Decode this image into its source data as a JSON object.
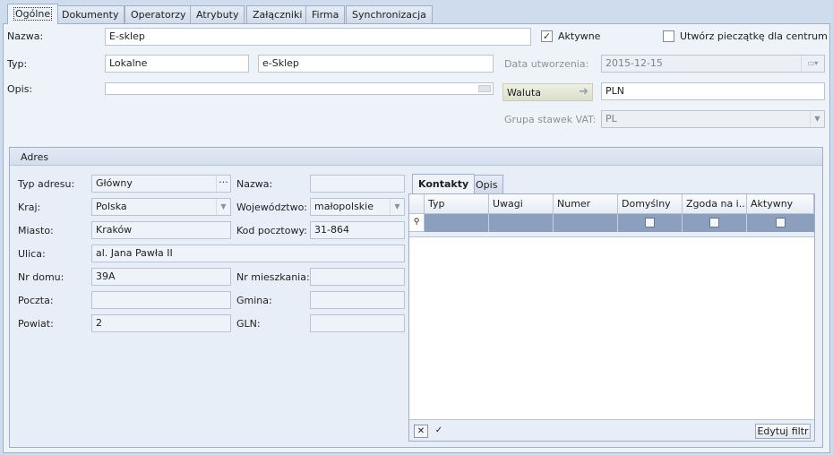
{
  "tabs": [
    "Ogólne",
    "Dokumenty",
    "Operatorzy",
    "Atrybuty",
    "Załączniki",
    "Firma",
    "Synchronizacja"
  ],
  "form": {
    "nazwa_label": "Nazwa:",
    "nazwa_value": "E-sklep",
    "aktywne_label": "Aktywne",
    "aktywne_checked": "✓",
    "pieczatka_label": "Utwórz pieczątkę dla centrum",
    "typ_label": "Typ:",
    "typ_value": "Lokalne",
    "typ_value2": "e-Sklep",
    "data_label": "Data utworzenia:",
    "data_value": "2015-12-15",
    "opis_label": "Opis:",
    "waluta_button": "Waluta",
    "waluta_value": "PLN",
    "vat_label": "Grupa stawek VAT:",
    "vat_value": "PL"
  },
  "adres": {
    "title": "Adres",
    "typ_adresu_label": "Typ adresu:",
    "typ_adresu_value": "Główny",
    "nazwa_label": "Nazwa:",
    "nazwa_value": "",
    "kraj_label": "Kraj:",
    "kraj_value": "Polska",
    "woj_label": "Województwo:",
    "woj_value": "małopolskie",
    "miasto_label": "Miasto:",
    "miasto_value": "Kraków",
    "kod_label": "Kod pocztowy:",
    "kod_value": "31-864",
    "ulica_label": "Ulica:",
    "ulica_value": "al. Jana Pawła II",
    "nr_domu_label": "Nr domu:",
    "nr_domu_value": "39A",
    "nr_mieszk_label": "Nr mieszkania:",
    "nr_mieszk_value": "",
    "poczta_label": "Poczta:",
    "poczta_value": "",
    "gmina_label": "Gmina:",
    "gmina_value": "",
    "powiat_label": "Powiat:",
    "powiat_value": "2",
    "gln_label": "GLN:",
    "gln_value": ""
  },
  "kontakty": {
    "tabs": [
      "Kontakty",
      "Opis"
    ],
    "columns": [
      "Typ",
      "Uwagi",
      "Numer",
      "Domyślny",
      "Zgoda na i...",
      "Aktywny"
    ],
    "edit_filter_button": "Edytuj filtr"
  }
}
